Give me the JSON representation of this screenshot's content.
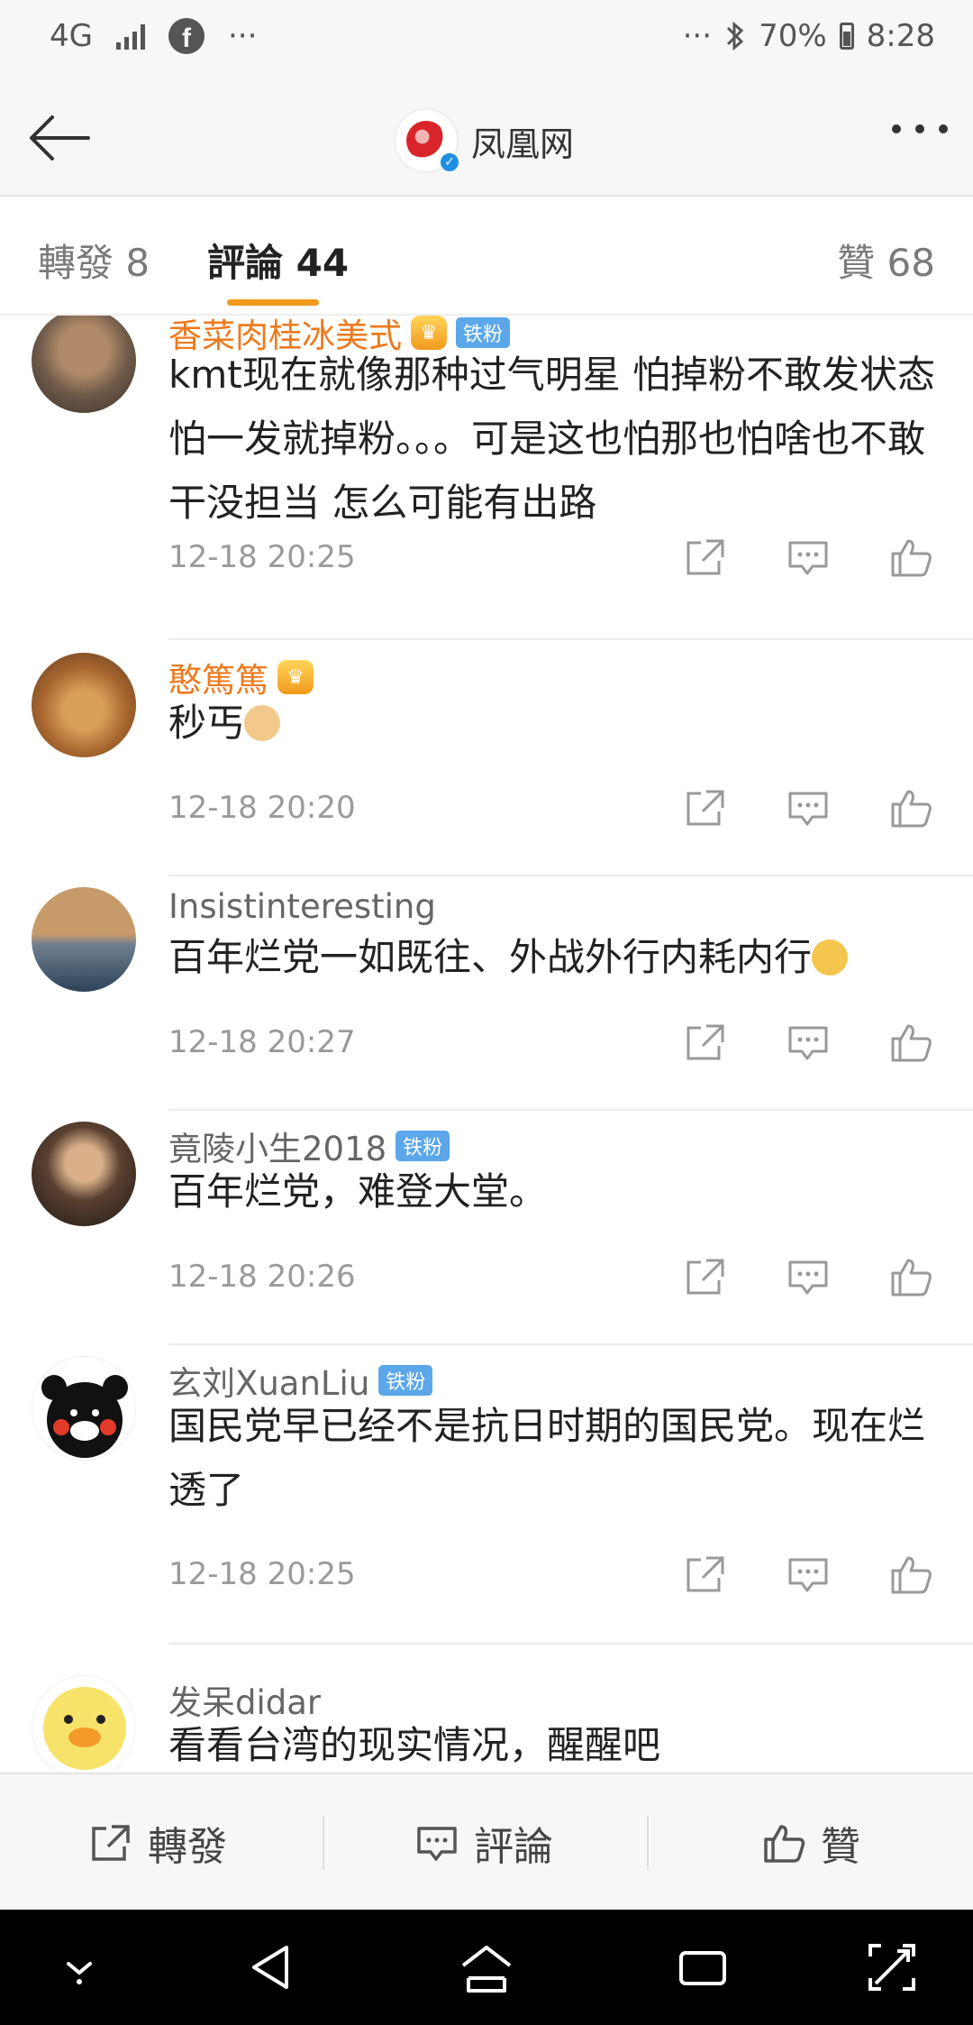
{
  "status_bar": {
    "network": "4G",
    "time": "8:28",
    "battery": "70%",
    "left_dots": "···",
    "right_dots": "···",
    "icons": [
      "signal-icon",
      "facebook-icon",
      "bluetooth-icon",
      "battery-icon"
    ]
  },
  "header": {
    "title": "凤凰网",
    "icons": [
      "back-arrow-icon",
      "logo",
      "verified-icon",
      "more-icon"
    ]
  },
  "tabs": {
    "repost": "轉發 8",
    "comments": "評論 44",
    "likes": "贊 68",
    "accent": "#f29a1c"
  },
  "comments": [
    {
      "name": "香菜肉桂冰美式",
      "badge": "铁粉",
      "text": "kmt现在就像那种过气明星 怕掉粉不敢发状态 怕一发就掉粉。。。可是这也怕那也怕啥也不敢干没担当 怎么可能有出路",
      "time": "12-18 20:25"
    },
    {
      "name": "憨篤篤",
      "text": "秒丐",
      "time": "12-18 20:20"
    },
    {
      "name": "Insistinteresting",
      "text": "百年烂党一如既往、外战外行内耗内行",
      "time": "12-18 20:27"
    },
    {
      "name": "竟陵小生2018",
      "badge": "铁粉",
      "text": "百年烂党，难登大堂。",
      "time": "12-18 20:26"
    },
    {
      "name": "玄刘XuanLiu",
      "badge": "铁粉",
      "text": "国民党早已经不是抗日时期的国民党。现在烂透了",
      "time": "12-18 20:25"
    },
    {
      "name": "发呆didar",
      "text": "看看台湾的现实情况，醒醒吧"
    }
  ],
  "bottom_bar": {
    "repost": "轉發",
    "comment": "評論",
    "like": "贊"
  },
  "colors": {
    "name_orange": "#ee7a1e",
    "badge_blue": "#5ba7ea",
    "verified_blue": "#1e8fe1"
  }
}
